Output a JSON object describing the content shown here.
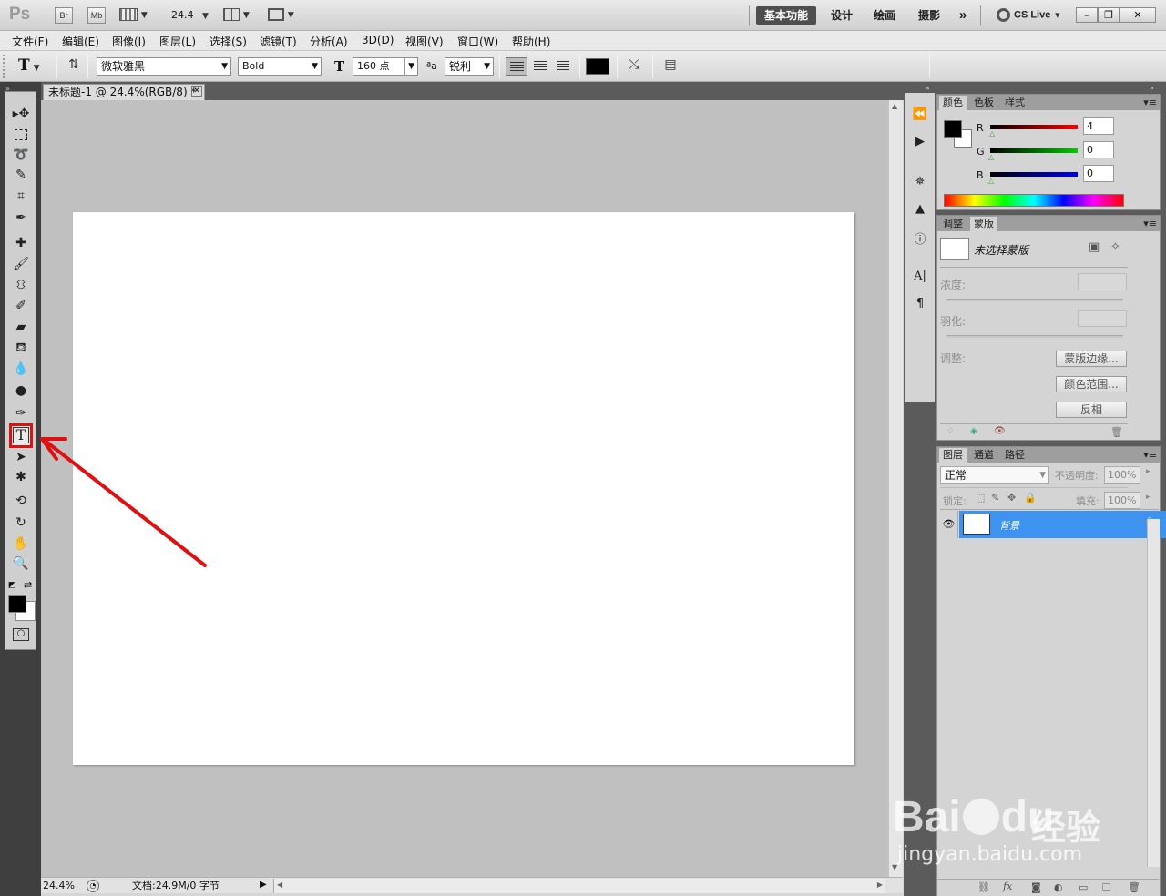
{
  "titlebar": {
    "logo": "Ps",
    "br_label": "Br",
    "mb_label": "Mb",
    "zoom_value": "24.4",
    "workspaces": [
      "基本功能",
      "设计",
      "绘画",
      "摄影"
    ],
    "more_label": "»",
    "cslive_label": "CS Live",
    "win_minimize": "–",
    "win_restore": "❐",
    "win_close": "✕"
  },
  "menubar": {
    "items": [
      "文件(F)",
      "编辑(E)",
      "图像(I)",
      "图层(L)",
      "选择(S)",
      "滤镜(T)",
      "分析(A)",
      "3D(D)",
      "视图(V)",
      "窗口(W)",
      "帮助(H)"
    ]
  },
  "options": {
    "tool_glyph": "T",
    "font_family": "微软雅黑",
    "font_style": "Bold",
    "font_size": "160 点",
    "aa_label": "ªa",
    "aa_value": "锐利",
    "text_color": "#000000"
  },
  "document": {
    "tab_title": "未标题-1 @ 24.4%(RGB/8) *",
    "zoom_status": "24.4%",
    "doc_info": "文档:24.9M/0 字节"
  },
  "color_panel": {
    "tabs": [
      "颜色",
      "色板",
      "样式"
    ],
    "r_label": "R",
    "g_label": "G",
    "b_label": "B",
    "r_value": "4",
    "g_value": "0",
    "b_value": "0"
  },
  "mask_panel": {
    "tabs": [
      "调整",
      "蒙版"
    ],
    "title": "未选择蒙版",
    "density_label": "浓度:",
    "feather_label": "羽化:",
    "refine_label": "调整:",
    "btn_edge": "蒙版边缘...",
    "btn_color_range": "颜色范围...",
    "btn_invert": "反相"
  },
  "layers_panel": {
    "tabs": [
      "图层",
      "通道",
      "路径"
    ],
    "blend_mode": "正常",
    "opacity_label": "不透明度:",
    "opacity_value": "100%",
    "lock_label": "锁定:",
    "fill_label": "填充:",
    "fill_value": "100%",
    "layer_name": "背景"
  },
  "watermark": {
    "brand": "Bai",
    "brand_tail": "du",
    "cn": "经验",
    "url": "jingyan.baidu.com"
  },
  "colors": {
    "annotation_red": "#e01010",
    "selection_blue": "#3d93f0",
    "canvas_bg": "#c0c0c0"
  }
}
